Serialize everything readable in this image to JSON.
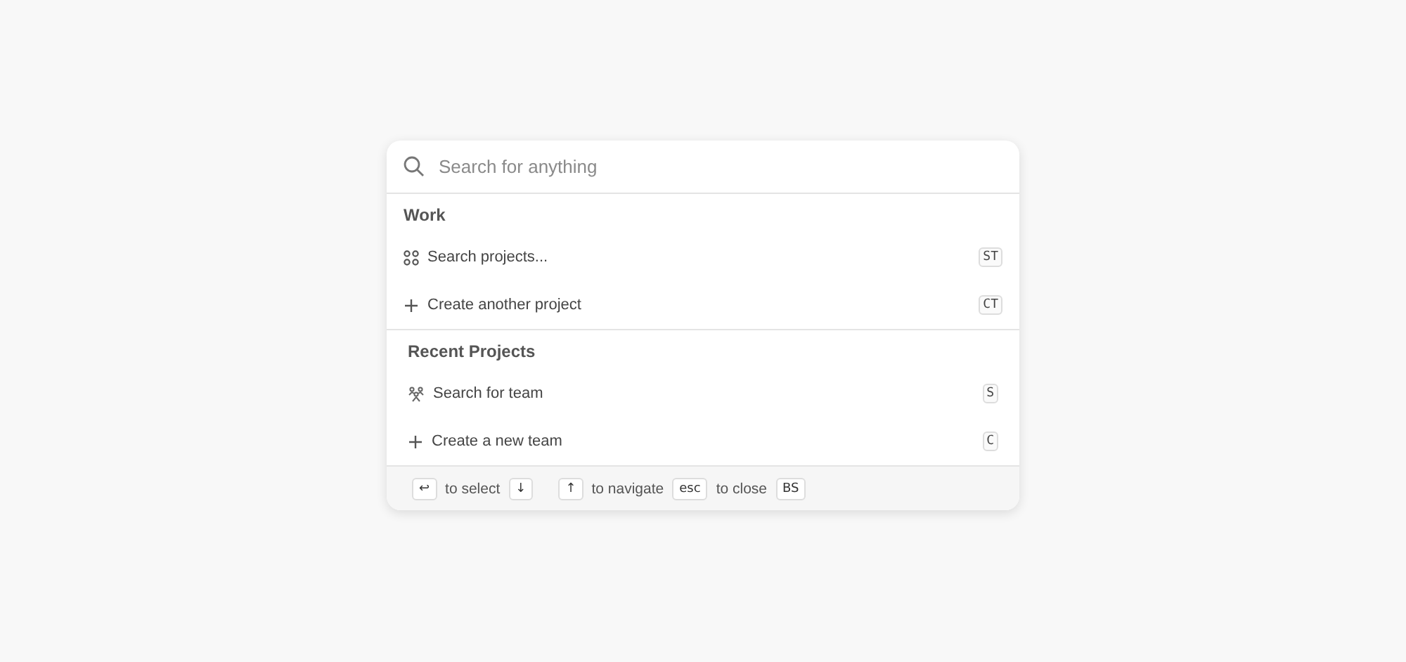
{
  "search": {
    "placeholder": "Search for anything"
  },
  "sections": [
    {
      "title": "Work",
      "items": [
        {
          "kind": "grid",
          "label": "Search projects...",
          "shortcut": "ST"
        },
        {
          "kind": "plus",
          "label": "Create another project",
          "shortcut": "CT"
        }
      ]
    },
    {
      "title": "Recent Projects",
      "items": [
        {
          "kind": "team",
          "label": "Search for team",
          "shortcut": "S"
        },
        {
          "kind": "plus",
          "label": "Create a new team",
          "shortcut": "C"
        }
      ]
    }
  ],
  "footer": [
    {
      "kind": "key",
      "text": "↩"
    },
    {
      "kind": "text",
      "text": "to select"
    },
    {
      "kind": "key",
      "text": "↓"
    },
    {
      "kind": "gap"
    },
    {
      "kind": "key",
      "text": "↑"
    },
    {
      "kind": "text",
      "text": "to navigate"
    },
    {
      "kind": "key",
      "text": "esc"
    },
    {
      "kind": "text",
      "text": "to close"
    },
    {
      "kind": "key",
      "text": "BS"
    }
  ]
}
